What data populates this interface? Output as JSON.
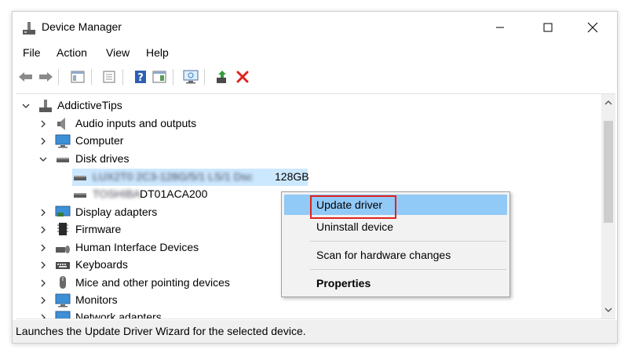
{
  "window": {
    "title": "Device Manager",
    "icon": "device-manager-icon"
  },
  "menu": [
    "File",
    "Action",
    "View",
    "Help"
  ],
  "tree": {
    "root": "AddictiveTips",
    "items": [
      {
        "label": "Audio inputs and outputs",
        "icon": "speaker-icon",
        "expanded": false
      },
      {
        "label": "Computer",
        "icon": "monitor-icon",
        "expanded": false
      },
      {
        "label": "Disk drives",
        "icon": "disk-drive-icon",
        "expanded": true,
        "children": [
          {
            "label_obscured": "LUX2T0 2C3-128G/5/1 LS/1 Dsc",
            "label_suffix": "128GB"
          },
          {
            "label_obscured": "TOSHIBA",
            "label_suffix": "DT01ACA200"
          }
        ]
      },
      {
        "label": "Display adapters",
        "icon": "display-adapter-icon",
        "expanded": false
      },
      {
        "label": "Firmware",
        "icon": "firmware-chip-icon",
        "expanded": false
      },
      {
        "label": "Human Interface Devices",
        "icon": "hid-icon",
        "expanded": false
      },
      {
        "label": "Keyboards",
        "icon": "keyboard-icon",
        "expanded": false
      },
      {
        "label": "Mice and other pointing devices",
        "icon": "mouse-icon",
        "expanded": false
      },
      {
        "label": "Monitors",
        "icon": "monitor-icon",
        "expanded": false
      },
      {
        "label": "Network adapters",
        "icon": "network-adapter-icon",
        "expanded": false
      }
    ]
  },
  "context_menu": {
    "items": [
      {
        "label": "Update driver",
        "highlighted": true,
        "bold": false
      },
      {
        "label": "Uninstall device",
        "highlighted": false,
        "bold": false
      },
      {
        "label": "Scan for hardware changes",
        "highlighted": false,
        "bold": false
      },
      {
        "label": "Properties",
        "highlighted": false,
        "bold": true
      }
    ]
  },
  "status": "Launches the Update Driver Wizard for the selected device.",
  "colors": {
    "highlight": "#91c9f7",
    "annotation_red": "#e0231c",
    "delete_red": "#e0231c",
    "tree_selection": "#cce8ff"
  }
}
